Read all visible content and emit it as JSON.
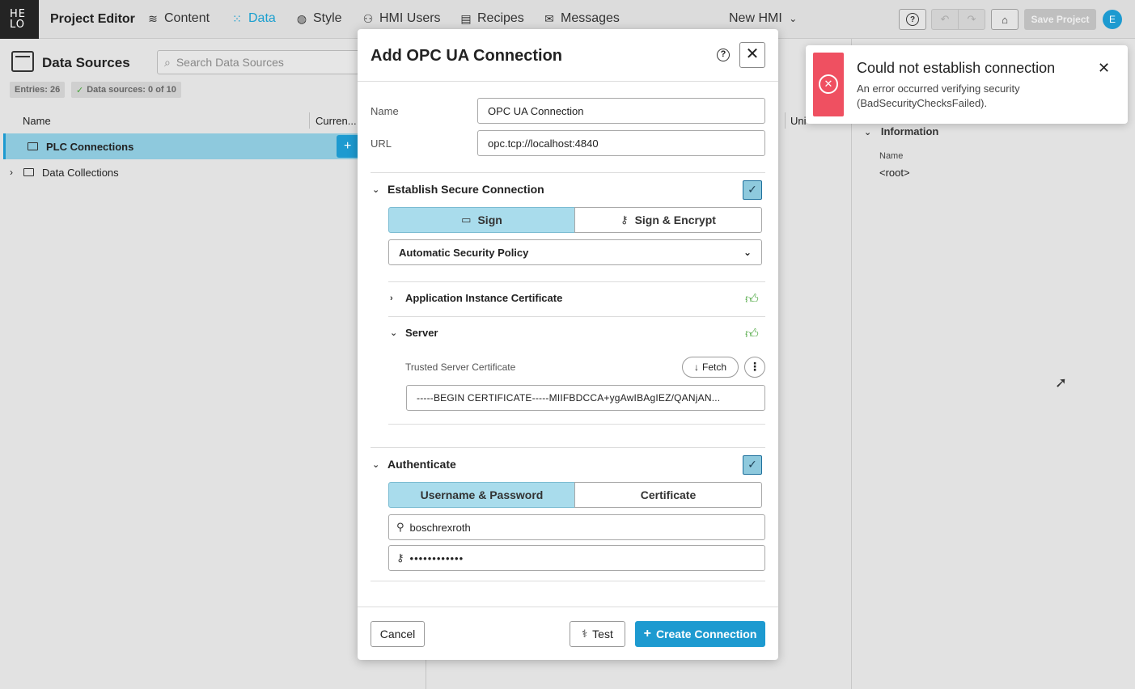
{
  "topbar": {
    "logo": "HE LO",
    "app_title": "Project Editor",
    "tabs": [
      {
        "label": "Content",
        "icon": "layers-icon"
      },
      {
        "label": "Data",
        "icon": "data-icon"
      },
      {
        "label": "Style",
        "icon": "palette-icon"
      },
      {
        "label": "HMI Users",
        "icon": "users-icon"
      },
      {
        "label": "Recipes",
        "icon": "recipe-icon"
      },
      {
        "label": "Messages",
        "icon": "mail-icon"
      }
    ],
    "active_tab": "Data",
    "hmi_name": "New HMI",
    "save_label": "Save Project",
    "avatar_initial": "E"
  },
  "left_panel": {
    "title": "Data Sources",
    "search_placeholder": "Search Data Sources",
    "entries_chip": "Entries: 26",
    "sources_chip": "Data sources: 0 of 10",
    "columns": [
      "Name",
      "Curren...",
      "Uni"
    ],
    "tree": [
      {
        "label": "PLC Connections",
        "selected": true
      },
      {
        "label": "Data Collections",
        "selected": false
      }
    ]
  },
  "right_panel": {
    "section": "Information",
    "field_label": "Name",
    "field_value": "<root>"
  },
  "modal": {
    "title": "Add OPC UA Connection",
    "name_label": "Name",
    "name_value": "OPC UA Connection",
    "url_label": "URL",
    "url_value": "opc.tcp://localhost:4840",
    "secure_section": "Establish Secure Connection",
    "secure_checked": true,
    "mode_sign": "Sign",
    "mode_sign_encrypt": "Sign & Encrypt",
    "mode_selected": "Sign",
    "policy": "Automatic Security Policy",
    "cert_section": "Application Instance Certificate",
    "server_section": "Server",
    "trusted_label": "Trusted Server Certificate",
    "fetch_label": "Fetch",
    "cert_value": "-----BEGIN CERTIFICATE-----MIIFBDCCA+ygAwIBAgIEZ/QANjAN...",
    "auth_section": "Authenticate",
    "auth_checked": true,
    "auth_userpass": "Username & Password",
    "auth_certificate": "Certificate",
    "username": "boschrexroth",
    "password_mask": "••••••••••••",
    "cancel_label": "Cancel",
    "test_label": "Test",
    "create_label": "Create Connection"
  },
  "toast": {
    "title": "Could not establish connection",
    "message": "An error occurred verifying security (BadSecurityChecksFailed).",
    "color": "#ef5061"
  },
  "colors": {
    "accent": "#1d9ad0",
    "selected_row": "#8ec9dd",
    "success": "#45a338"
  }
}
